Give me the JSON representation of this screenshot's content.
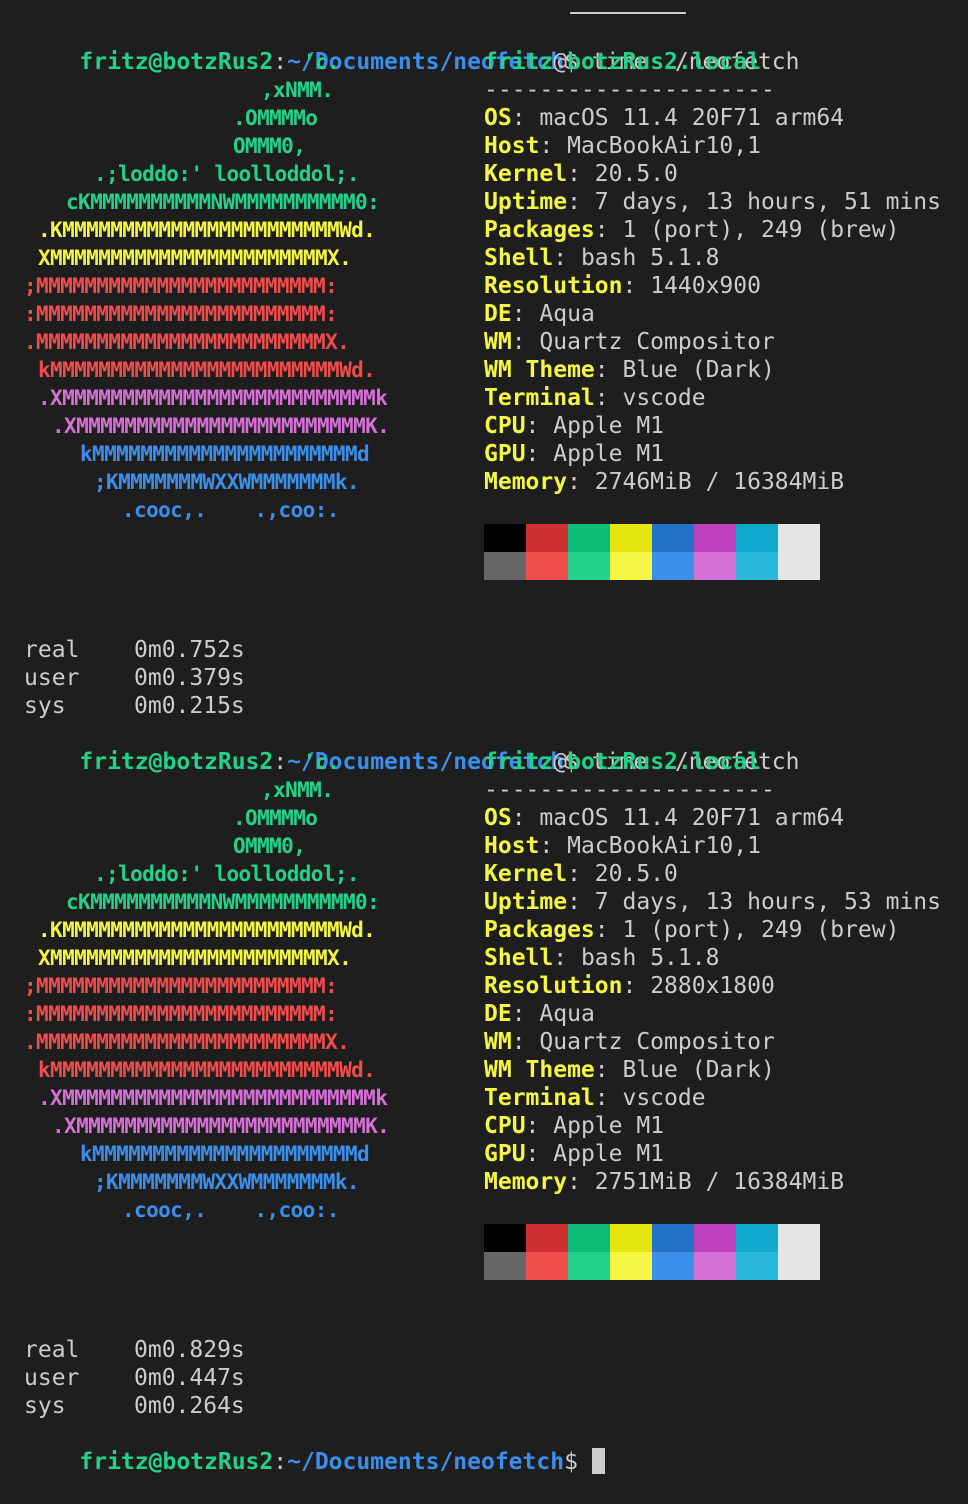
{
  "prompt": {
    "user_host": "fritz@botzRus2",
    "sep": ":",
    "path": "~/Documents/neofetch",
    "symbol": "$",
    "command": " time ./neofetch"
  },
  "logo_lines": [
    "'c.",
    ",xNMM.",
    ".OMMMMo",
    "OMMM0,",
    ".;loddo:' loolloddol;.",
    "cKMMMMMMMMMMNWMMMMMMMMMM0:",
    ".KMMMMMMMMMMMMMMMMMMMMMMMWd.",
    "XMMMMMMMMMMMMMMMMMMMMMMMX.",
    ";MMMMMMMMMMMMMMMMMMMMMMMM:",
    ":MMMMMMMMMMMMMMMMMMMMMMMM:",
    ".MMMMMMMMMMMMMMMMMMMMMMMMX.",
    "kMMMMMMMMMMMMMMMMMMMMMMMMWd.",
    ".XMMMMMMMMMMMMMMMMMMMMMMMMMMk",
    ".XMMMMMMMMMMMMMMMMMMMMMMMMK.",
    "kMMMMMMMMMMMMMMMMMMMMMMd",
    ";KMMMMMMMWXXWMMMMMMMk.",
    ".cooc,.    .,coo:."
  ],
  "runs": [
    {
      "title_user": "fritz",
      "title_at": "@",
      "title_host": "botzRus2.local",
      "separator": "---------------------",
      "info": [
        {
          "key": "OS",
          "value": "macOS 11.4 20F71 arm64"
        },
        {
          "key": "Host",
          "value": "MacBookAir10,1"
        },
        {
          "key": "Kernel",
          "value": "20.5.0"
        },
        {
          "key": "Uptime",
          "value": "7 days, 13 hours, 51 mins"
        },
        {
          "key": "Packages",
          "value": "1 (port), 249 (brew)"
        },
        {
          "key": "Shell",
          "value": "bash 5.1.8"
        },
        {
          "key": "Resolution",
          "value": "1440x900"
        },
        {
          "key": "DE",
          "value": "Aqua"
        },
        {
          "key": "WM",
          "value": "Quartz Compositor"
        },
        {
          "key": "WM Theme",
          "value": "Blue (Dark)"
        },
        {
          "key": "Terminal",
          "value": "vscode"
        },
        {
          "key": "CPU",
          "value": "Apple M1"
        },
        {
          "key": "GPU",
          "value": "Apple M1"
        },
        {
          "key": "Memory",
          "value": "2746MiB / 16384MiB"
        }
      ],
      "timing": [
        {
          "label": "real",
          "value": "0m0.752s"
        },
        {
          "label": "user",
          "value": "0m0.379s"
        },
        {
          "label": "sys",
          "value": "0m0.215s"
        }
      ]
    },
    {
      "title_user": "fritz",
      "title_at": "@",
      "title_host": "botzRus2.local",
      "separator": "---------------------",
      "info": [
        {
          "key": "OS",
          "value": "macOS 11.4 20F71 arm64"
        },
        {
          "key": "Host",
          "value": "MacBookAir10,1"
        },
        {
          "key": "Kernel",
          "value": "20.5.0"
        },
        {
          "key": "Uptime",
          "value": "7 days, 13 hours, 53 mins"
        },
        {
          "key": "Packages",
          "value": "1 (port), 249 (brew)"
        },
        {
          "key": "Shell",
          "value": "bash 5.1.8"
        },
        {
          "key": "Resolution",
          "value": "2880x1800"
        },
        {
          "key": "DE",
          "value": "Aqua"
        },
        {
          "key": "WM",
          "value": "Quartz Compositor"
        },
        {
          "key": "WM Theme",
          "value": "Blue (Dark)"
        },
        {
          "key": "Terminal",
          "value": "vscode"
        },
        {
          "key": "CPU",
          "value": "Apple M1"
        },
        {
          "key": "GPU",
          "value": "Apple M1"
        },
        {
          "key": "Memory",
          "value": "2751MiB / 16384MiB"
        }
      ],
      "timing": [
        {
          "label": "real",
          "value": "0m0.829s"
        },
        {
          "label": "user",
          "value": "0m0.447s"
        },
        {
          "label": "sys",
          "value": "0m0.264s"
        }
      ]
    }
  ],
  "palette_top": [
    "#000000",
    "#cd3131",
    "#0dbc79",
    "#e5e510",
    "#2472c8",
    "#bc3fbc",
    "#11a8cd",
    "#e5e5e5"
  ],
  "palette_bottom": [
    "#666666",
    "#f14c4c",
    "#23d18b",
    "#f5f543",
    "#3b8eea",
    "#d670d6",
    "#29b8db",
    "#e5e5e5"
  ]
}
